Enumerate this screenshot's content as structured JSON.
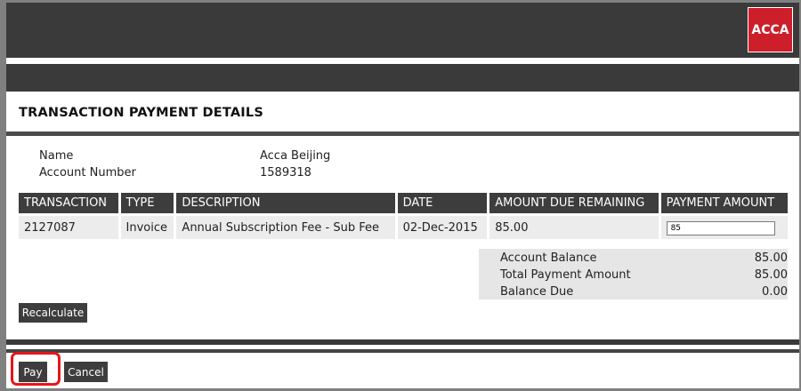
{
  "brand": {
    "logo_text": "ACCA",
    "logo_color": "#cc1f2a",
    "band_color": "#3a3a3b"
  },
  "page": {
    "title": "TRANSACTION PAYMENT DETAILS"
  },
  "account": {
    "name_label": "Name",
    "name_value": "Acca Beijing",
    "number_label": "Account Number",
    "number_value": "1589318"
  },
  "table": {
    "headers": [
      "TRANSACTION",
      "TYPE",
      "DESCRIPTION",
      "DATE",
      "AMOUNT DUE REMAINING",
      "PAYMENT AMOUNT"
    ],
    "rows": [
      {
        "transaction": "2127087",
        "type": "Invoice",
        "description": "Annual Subscription Fee - Sub Fee",
        "date": "02-Dec-2015",
        "amount_due": "85.00",
        "payment_amount": "85"
      }
    ]
  },
  "summary": {
    "account_balance_label": "Account Balance",
    "account_balance_value": "85.00",
    "total_payment_label": "Total Payment Amount",
    "total_payment_value": "85.00",
    "balance_due_label": "Balance Due",
    "balance_due_value": "0.00"
  },
  "buttons": {
    "recalculate": "Recalculate",
    "pay": "Pay",
    "cancel": "Cancel"
  },
  "highlight_color": "#e8141a"
}
